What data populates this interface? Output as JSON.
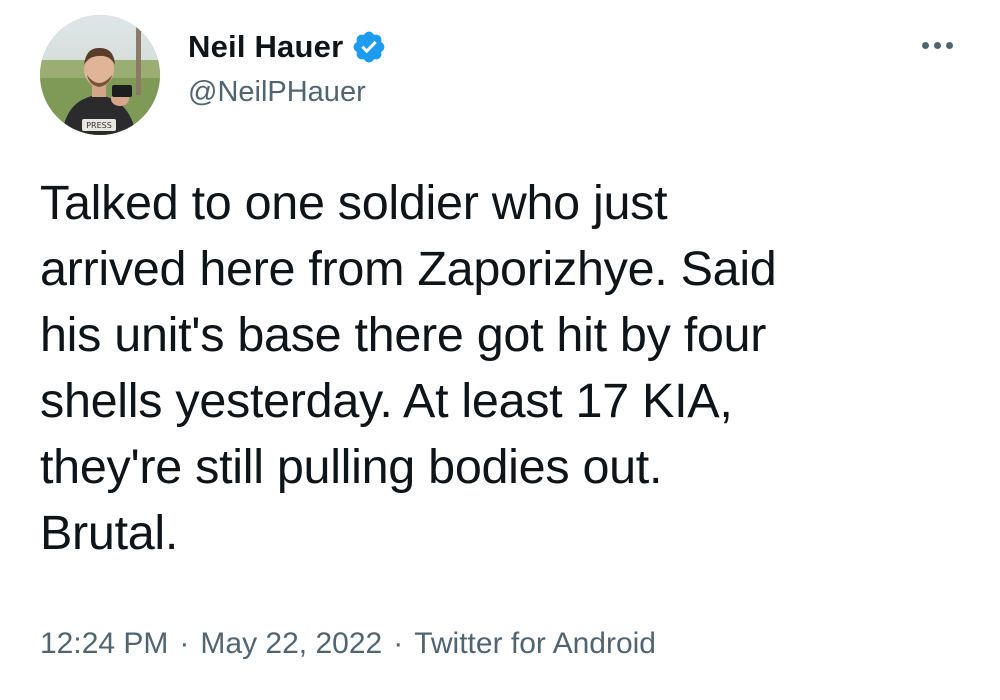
{
  "author": {
    "display_name": "Neil Hauer",
    "handle": "@NeilPHauer",
    "verified": true,
    "avatar_icon": "profile-photo"
  },
  "menu": {
    "icon": "more-horizontal-icon"
  },
  "tweet": {
    "text": "Talked to one soldier who just\narrived here from Zaporizhye. Said\nhis unit's base there got hit by four\nshells yesterday. At least 17 KIA,\nthey're still pulling bodies out.\nBrutal."
  },
  "meta": {
    "time": "12:24 PM",
    "date": "May 22, 2022",
    "separator": "·",
    "source": "Twitter for Android"
  },
  "colors": {
    "text_primary": "#0f1419",
    "text_secondary": "#536471",
    "verified_blue": "#1d9bf0"
  }
}
